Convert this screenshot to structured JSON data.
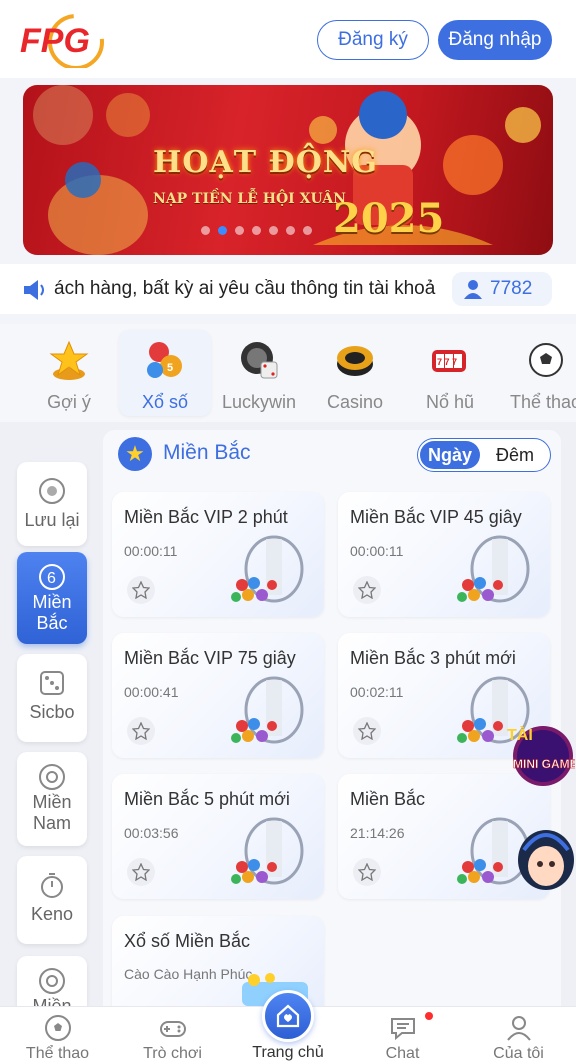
{
  "header": {
    "logo_text": "FPG",
    "register_label": "Đăng ký",
    "login_label": "Đăng nhập"
  },
  "banner": {
    "title": "HOẠT ĐỘNG",
    "subtitle": "NẠP TIỀN LỄ HỘI XUÂN",
    "year": "2025",
    "slide_count": 7,
    "active_slide": 1
  },
  "marquee": {
    "text": "ách hàng, bất kỳ ai yêu cầu thông tin tài khoả",
    "online_count": "7782"
  },
  "categories": [
    {
      "label": "Gợi ý",
      "icon": "star-medal-icon"
    },
    {
      "label": "Xổ số",
      "icon": "lottery-balls-icon",
      "active": true
    },
    {
      "label": "Luckywin",
      "icon": "dice-icon"
    },
    {
      "label": "Casino",
      "icon": "poker-chip-icon"
    },
    {
      "label": "Nổ hũ",
      "icon": "slot-machine-icon"
    },
    {
      "label": "Thể thao",
      "icon": "soccer-ball-icon"
    }
  ],
  "sidebar": [
    {
      "label": "Lưu lại",
      "icon": "bookmark-disc-icon"
    },
    {
      "label": "Miền Bắc",
      "icon": "ball-six-icon",
      "active": true
    },
    {
      "label": "Sicbo",
      "icon": "dice-icon"
    },
    {
      "label": "Miền Nam",
      "icon": "ball-icon"
    },
    {
      "label": "Keno",
      "icon": "stopwatch-icon"
    },
    {
      "label": "Miền",
      "icon": "ball-icon"
    }
  ],
  "panel": {
    "region_title": "Miền Bắc",
    "toggle_day": "Ngày",
    "toggle_night": "Đêm"
  },
  "games": [
    {
      "title": "Miền Bắc VIP 2 phút",
      "time": "00:00:11"
    },
    {
      "title": "Miền Bắc VIP 45 giây",
      "time": "00:00:11"
    },
    {
      "title": "Miền Bắc VIP 75 giây",
      "time": "00:00:41"
    },
    {
      "title": "Miền Bắc 3 phút mới",
      "time": "00:02:11"
    },
    {
      "title": "Miền Bắc 5 phút mới",
      "time": "00:03:56"
    },
    {
      "title": "Miền Bắc",
      "time": "21:14:26"
    },
    {
      "title": "Xổ số Miền Bắc",
      "time": "Cào Cào Hạnh Phúc"
    }
  ],
  "floating": {
    "mini_game_top": "TÀI",
    "mini_game_label": "MINI GAME"
  },
  "bottom_nav": [
    {
      "label": "Thể thao",
      "icon": "soccer-ball-icon"
    },
    {
      "label": "Trò chơi",
      "icon": "gamepad-icon"
    },
    {
      "label": "Trang chủ",
      "icon": "home-heart-icon",
      "active": true
    },
    {
      "label": "Chat",
      "icon": "chat-icon"
    },
    {
      "label": "Của tôi",
      "icon": "user-icon"
    }
  ],
  "colors": {
    "primary": "#3d6fe0",
    "banner_red": "#c41820",
    "accent_gold": "#ffd02a",
    "notification_red": "#ff2d2d"
  }
}
